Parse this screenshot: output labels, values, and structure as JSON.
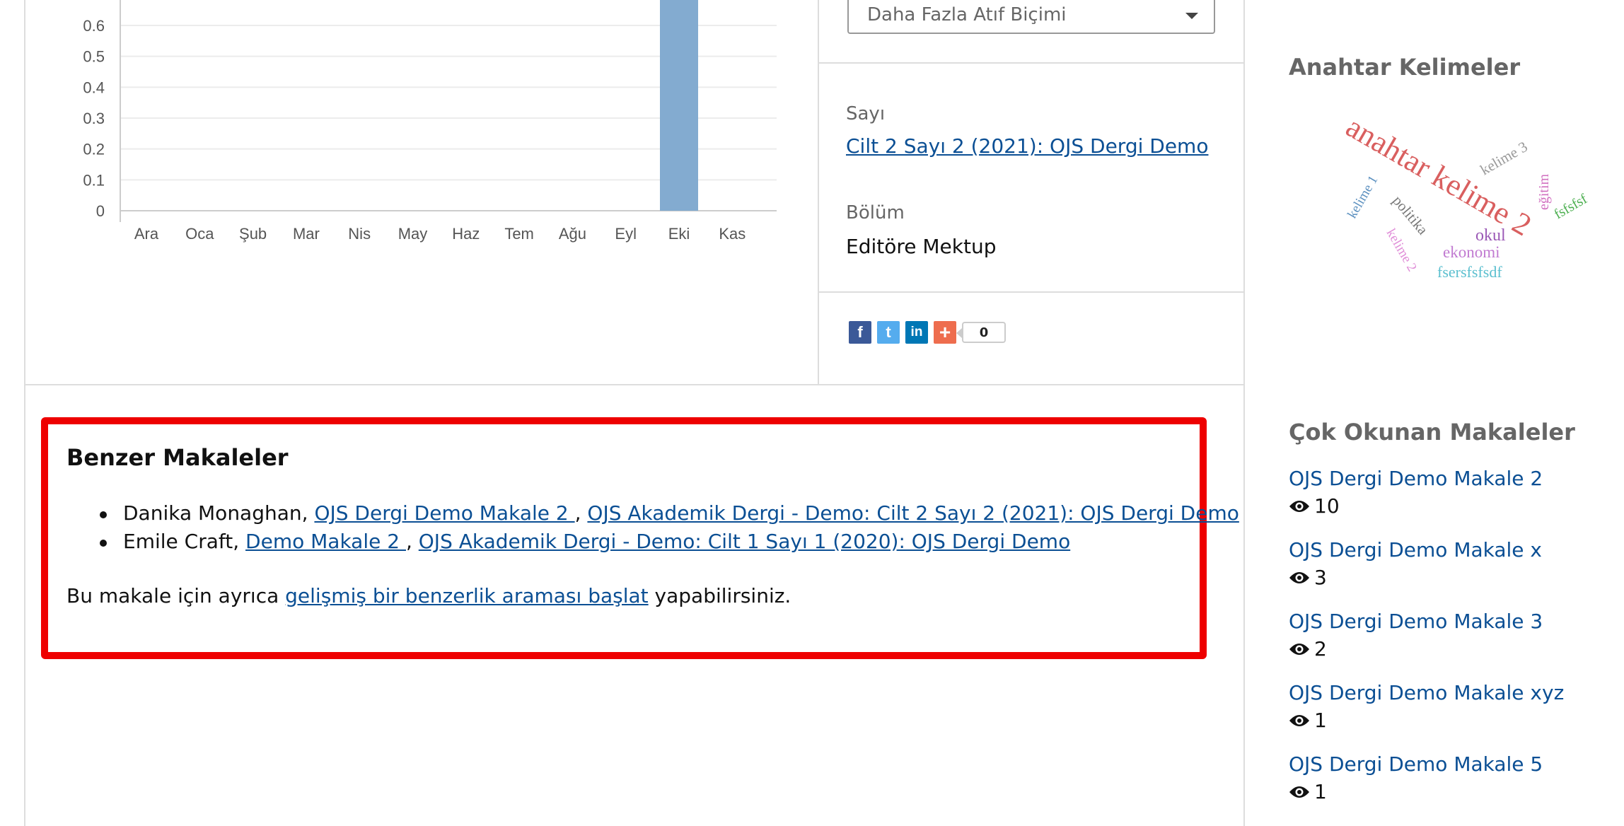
{
  "chart_data": {
    "type": "bar",
    "categories": [
      "Ara",
      "Oca",
      "Şub",
      "Mar",
      "Nis",
      "May",
      "Haz",
      "Tem",
      "Ağu",
      "Eyl",
      "Eki",
      "Kas"
    ],
    "values": [
      0,
      0,
      0,
      0,
      0,
      0,
      0,
      0,
      0,
      0,
      1,
      0
    ],
    "yticks": [
      "0",
      "0.1",
      "0.2",
      "0.3",
      "0.4",
      "0.5",
      "0.6"
    ],
    "ylim": [
      0,
      0.6
    ],
    "grid": true,
    "bar_color": "#83abd0"
  },
  "citation": {
    "select_label": "Daha Fazla Atıf Biçimi"
  },
  "issue": {
    "label": "Sayı",
    "link": "Cilt 2 Sayı 2 (2021): OJS Dergi Demo"
  },
  "section": {
    "label": "Bölüm",
    "value": "Editöre Mektup"
  },
  "share": {
    "count": "0",
    "buttons": [
      {
        "name": "facebook-share-button",
        "glyph": "f"
      },
      {
        "name": "twitter-share-button",
        "glyph": "t"
      },
      {
        "name": "linkedin-share-button",
        "glyph": "in"
      },
      {
        "name": "more-share-button",
        "glyph": "+"
      }
    ]
  },
  "similar": {
    "title": "Benzer Makaleler",
    "items": [
      {
        "author": "Danika Monaghan, ",
        "article": "OJS Dergi Demo Makale 2 ",
        "sep": ", ",
        "issue": "OJS Akademik Dergi - Demo: Cilt 2 Sayı 2 (2021): OJS Dergi Demo"
      },
      {
        "author": "Emile Craft, ",
        "article": "Demo Makale 2 ",
        "sep": ", ",
        "issue": "OJS Akademik Dergi - Demo: Cilt 1 Sayı 1 (2020): OJS Dergi Demo"
      }
    ],
    "note_before": "Bu makale için ayrıca ",
    "note_link": "gelişmiş bir benzerlik araması başlat",
    "note_after": " yapabilirsiniz."
  },
  "keywords": {
    "heading": "Anahtar Kelimeler",
    "cloud": [
      {
        "text": "anahtar kelime 2",
        "color": "#d95f5f"
      },
      {
        "text": "kelime 3",
        "color": "#9a9a9a"
      },
      {
        "text": "kelime 1",
        "color": "#5a8fbf"
      },
      {
        "text": "eğitim",
        "color": "#d16fc0"
      },
      {
        "text": "fsfsfsf",
        "color": "#4caf50"
      },
      {
        "text": "politika",
        "color": "#777777"
      },
      {
        "text": "okul",
        "color": "#9b59b6"
      },
      {
        "text": "ekonomi",
        "color": "#c17ad1"
      },
      {
        "text": "kelime 2",
        "color": "#e08fd8"
      },
      {
        "text": "fsersfsfsdf",
        "color": "#5bbfcf"
      }
    ]
  },
  "popular": {
    "heading": "Çok Okunan Makaleler",
    "items": [
      {
        "title": "OJS Dergi Demo Makale 2",
        "views": "10"
      },
      {
        "title": "OJS Dergi Demo Makale x",
        "views": "3"
      },
      {
        "title": "OJS Dergi Demo Makale 3",
        "views": "2"
      },
      {
        "title": "OJS Dergi Demo Makale xyz",
        "views": "1"
      },
      {
        "title": "OJS Dergi Demo Makale 5",
        "views": "1"
      }
    ]
  }
}
